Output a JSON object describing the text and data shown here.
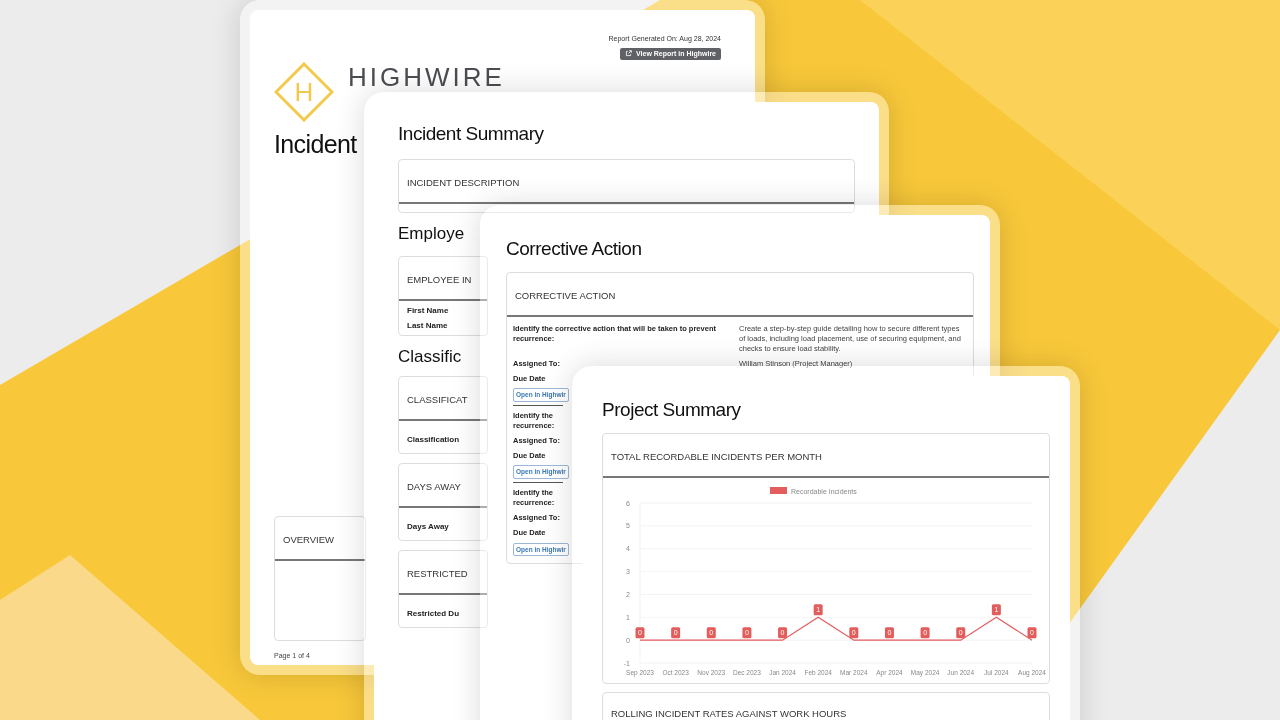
{
  "report_cover": {
    "generated": "Report Generated On: Aug 28, 2024",
    "view_button": "View Report in Highwire",
    "logo_letter": "H",
    "brand": "HIGHWIRE",
    "title": "Incident",
    "overview": "OVERVIEW",
    "page": "Page 1 of 4"
  },
  "incident_summary": {
    "title": "Incident Summary",
    "description_header": "INCIDENT DESCRIPTION",
    "employee_heading": "Employe",
    "employee_header": "EMPLOYEE IN",
    "employee_fields": [
      "First Name",
      "Last Name"
    ],
    "classification_heading": "Classific",
    "sections": [
      {
        "header": "CLASSIFICAT",
        "field": "Classification"
      },
      {
        "header": "DAYS AWAY",
        "field": "Days Away"
      },
      {
        "header": "RESTRICTED",
        "field": "Restricted Du"
      }
    ]
  },
  "corrective_action": {
    "title": "Corrective Action",
    "header": "CORRECTIVE ACTION",
    "actions": [
      {
        "question": [
          "Identify the corrective action that will be taken to prevent",
          "recurrence:"
        ],
        "answer": "Create a step-by-step guide detailing how to secure different types of loads, including load placement, use of securing equipment, and checks to ensure load stability.",
        "assigned_label": "Assigned To:",
        "assigned": "William Stinson (Project Manager)",
        "due_label": "Due Date",
        "button": "Open in Highwir"
      },
      {
        "question": [
          "Identify the",
          "recurrence:"
        ],
        "assigned_label": "Assigned To:",
        "due_label": "Due Date",
        "button": "Open in Highwir"
      },
      {
        "question": [
          "Identify the",
          "recurrence:"
        ],
        "assigned_label": "Assigned To:",
        "due_label": "Due Date",
        "button": "Open in Highwir"
      }
    ]
  },
  "project_summary": {
    "title": "Project Summary",
    "chart_header": "TOTAL RECORDABLE INCIDENTS PER MONTH",
    "chart_data": {
      "type": "line",
      "categories": [
        "Sep 2023",
        "Oct 2023",
        "Nov 2023",
        "Dec 2023",
        "Jan 2024",
        "Feb 2024",
        "Mar 2024",
        "Apr 2024",
        "May 2024",
        "Jun 2024",
        "Jul 2024",
        "Aug 2024"
      ],
      "series": [
        {
          "name": "Recordable Incidents",
          "color": "#e35d5d",
          "values": [
            0,
            0,
            0,
            0,
            0,
            1,
            0,
            0,
            0,
            0,
            1,
            0
          ]
        }
      ],
      "ylim": [
        -1,
        6
      ],
      "yticks": [
        -1,
        0,
        1,
        2,
        3,
        4,
        5,
        6
      ],
      "grid": true,
      "data_labels": true
    },
    "next_header": "ROLLING INCIDENT RATES AGAINST WORK HOURS"
  }
}
